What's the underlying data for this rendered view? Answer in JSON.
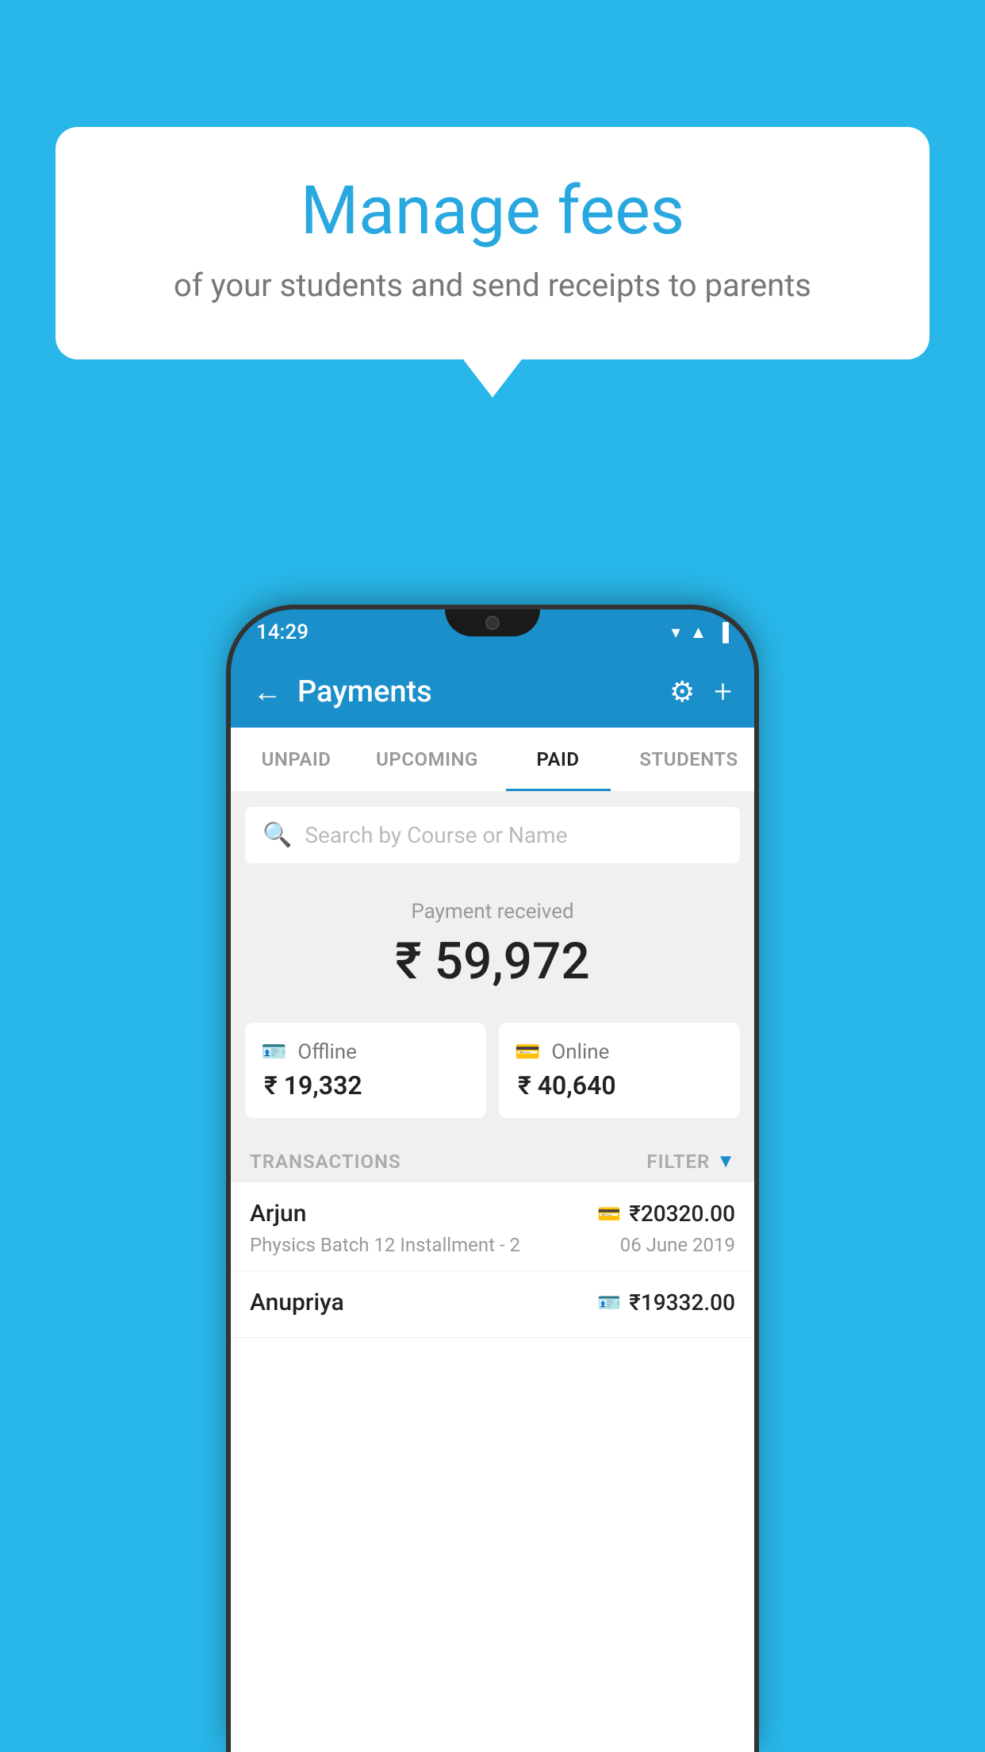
{
  "background_color": "#29b6e8",
  "bubble": {
    "title": "Manage fees",
    "subtitle": "of your students and send receipts to parents"
  },
  "status_bar": {
    "time": "14:29",
    "icons": [
      "wifi",
      "signal",
      "battery"
    ]
  },
  "app_bar": {
    "title": "Payments",
    "back_icon": "←",
    "settings_icon": "⚙",
    "add_icon": "+"
  },
  "tabs": [
    {
      "label": "UNPAID",
      "active": false
    },
    {
      "label": "UPCOMING",
      "active": false
    },
    {
      "label": "PAID",
      "active": true
    },
    {
      "label": "STUDENTS",
      "active": false
    }
  ],
  "search": {
    "placeholder": "Search by Course or Name"
  },
  "payment_summary": {
    "label": "Payment received",
    "amount": "₹ 59,972",
    "methods": [
      {
        "icon": "📋",
        "label": "Offline",
        "amount": "₹ 19,332"
      },
      {
        "icon": "💳",
        "label": "Online",
        "amount": "₹ 40,640"
      }
    ]
  },
  "transactions_section": {
    "label": "TRANSACTIONS",
    "filter_label": "FILTER"
  },
  "transactions": [
    {
      "name": "Arjun",
      "course": "Physics Batch 12 Installment - 2",
      "amount": "₹20320.00",
      "date": "06 June 2019",
      "method_icon": "💳"
    },
    {
      "name": "Anupriya",
      "course": "",
      "amount": "₹19332.00",
      "date": "",
      "method_icon": "📋"
    }
  ]
}
